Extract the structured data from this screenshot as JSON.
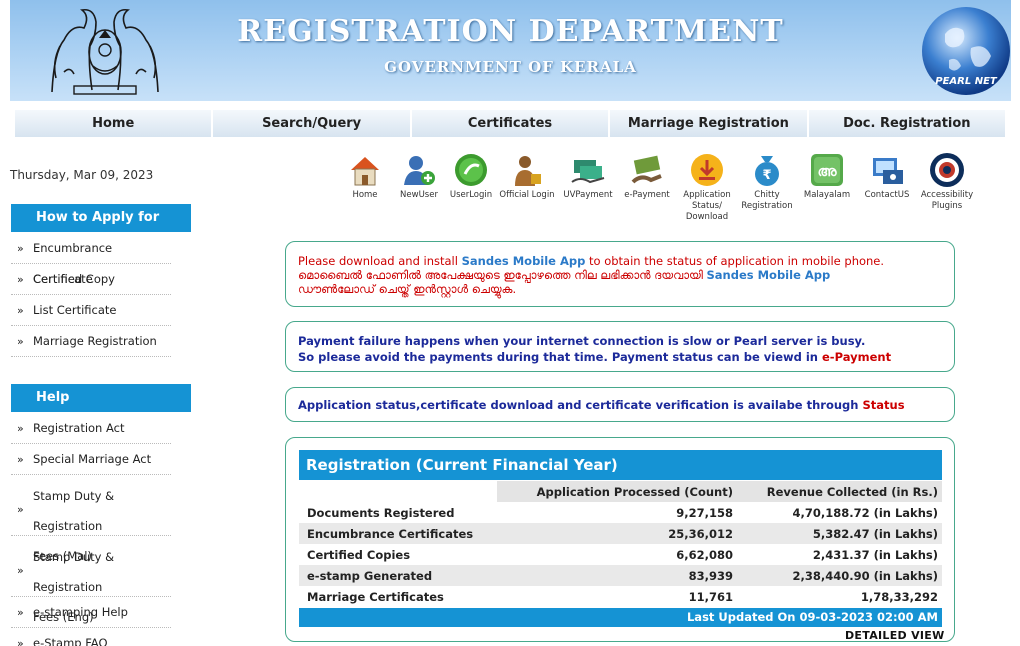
{
  "header": {
    "title": "REGISTRATION DEPARTMENT",
    "subtitle": "GOVERNMENT OF KERALA",
    "globe_text": "PEARL NET"
  },
  "nav": [
    "Home",
    "Search/Query",
    "Certificates",
    "Marriage Registration",
    "Doc. Registration"
  ],
  "date": "Thursday, Mar 09, 2023",
  "sidebar": {
    "apply_heading": "How to Apply for",
    "apply_items": [
      "Encumbrance Certificate",
      "Certified Copy",
      "List Certificate",
      "Marriage Registration"
    ],
    "help_heading": "Help",
    "help_items": [
      {
        "line1": "Registration Act"
      },
      {
        "line1": "Special Marriage Act"
      },
      {
        "line1": "Stamp Duty & Registration",
        "line2": "Fees (Mal)"
      },
      {
        "line1": "Stamp Duty & Registration",
        "line2": "Fees (Eng)"
      },
      {
        "line1": "e-stamping Help"
      },
      {
        "line1": "e-Stamp FAQ"
      }
    ],
    "bullet": "»"
  },
  "icons": [
    {
      "label": "Home",
      "icon": "house-icon"
    },
    {
      "label": "NewUser",
      "icon": "new-user-icon"
    },
    {
      "label": "UserLogin",
      "icon": "user-login-icon"
    },
    {
      "label": "Official Login",
      "icon": "official-login-icon"
    },
    {
      "label": "UVPayment",
      "icon": "uv-payment-icon"
    },
    {
      "label": "e-Payment",
      "icon": "e-payment-icon"
    },
    {
      "label": "Application Status/ Download",
      "icon": "download-icon"
    },
    {
      "label": "Chitty Registration",
      "icon": "chitty-icon"
    },
    {
      "label": "Malayalam",
      "icon": "malayalam-icon"
    },
    {
      "label": "ContactUS",
      "icon": "contact-icon"
    },
    {
      "label": "Accessibility Plugins",
      "icon": "accessibility-icon"
    }
  ],
  "notices": {
    "sandes_pre": "Please download and install ",
    "sandes_link": "Sandes Mobile App",
    "sandes_post": " to obtain the status of application in mobile phone.",
    "sandes_mal_1": "മൊബൈൽ ഫോണിൽ അപേക്ഷയുടെ ഇപ്പോഴത്തെ നില ലഭിക്കാൻ ദയവായി ",
    "sandes_mal_link": "Sandes Mobile App",
    "sandes_mal_2": "ഡൗൺലോഡ് ചെയ്ത് ഇൻസ്റ്റാൾ ചെയ്യുക.",
    "payment_line1": "Payment failure happens when your internet connection is slow or Pearl server is busy.",
    "payment_line2_pre": "So please avoid the payments during that time. Payment status can be viewd in ",
    "payment_link": "e-Payment",
    "status_pre": "Application status,certificate download and certificate verification is availabe through ",
    "status_link": "Status"
  },
  "registration": {
    "title": "Registration (Current Financial Year)",
    "columns": [
      "",
      "Application Processed (Count)",
      "Revenue Collected (in Rs.)"
    ],
    "rows": [
      {
        "label": "Documents Registered",
        "count": "9,27,158",
        "revenue": "4,70,188.72 (in Lakhs)"
      },
      {
        "label": "Encumbrance Certificates",
        "count": "25,36,012",
        "revenue": "5,382.47 (in Lakhs)"
      },
      {
        "label": "Certified Copies",
        "count": "6,62,080",
        "revenue": "2,431.37 (in Lakhs)"
      },
      {
        "label": "e-stamp Generated",
        "count": "83,939",
        "revenue": "2,38,440.90 (in Lakhs)"
      },
      {
        "label": "Marriage Certificates",
        "count": "11,761",
        "revenue": "1,78,33,292"
      }
    ],
    "updated": "Last Updated On 09-03-2023 02:00 AM",
    "detailed_view": "DETAILED VIEW"
  },
  "colors": {
    "accent_blue": "#1593d4",
    "notice_border": "#47a88c",
    "link_red": "#cc0000",
    "text_navy": "#1c2a9a"
  }
}
